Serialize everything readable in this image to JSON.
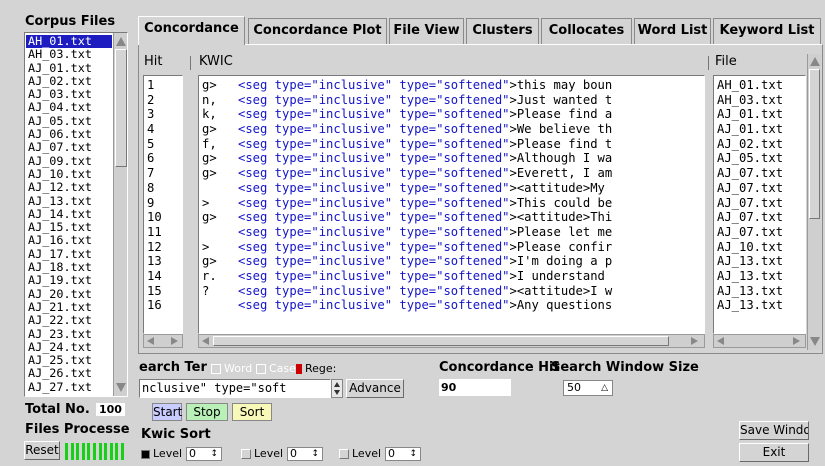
{
  "corpus": {
    "title": "Corpus Files",
    "files": [
      "AH_01.txt",
      "AH_03.txt",
      "AJ_01.txt",
      "AJ_02.txt",
      "AJ_03.txt",
      "AJ_04.txt",
      "AJ_05.txt",
      "AJ_06.txt",
      "AJ_07.txt",
      "AJ_09.txt",
      "AJ_10.txt",
      "AJ_12.txt",
      "AJ_13.txt",
      "AJ_14.txt",
      "AJ_15.txt",
      "AJ_16.txt",
      "AJ_17.txt",
      "AJ_18.txt",
      "AJ_19.txt",
      "AJ_20.txt",
      "AJ_21.txt",
      "AJ_22.txt",
      "AJ_23.txt",
      "AJ_24.txt",
      "AJ_25.txt",
      "AJ_26.txt",
      "AJ_27.txt"
    ],
    "selected_index": 0,
    "total_label": "Total No.",
    "total_value": "100",
    "processed_label": "Files Processe",
    "reset_label": "Reset"
  },
  "tabs": [
    "Concordance",
    "Concordance Plot",
    "File View",
    "Clusters",
    "Collocates",
    "Word List",
    "Keyword List"
  ],
  "active_tab": 0,
  "concordance": {
    "hit_header": "Hit",
    "kwic_header": "KWIC",
    "file_header": "File",
    "rows": [
      {
        "hit": "1",
        "left": "g>",
        "tag1": "<seg type=\"inclusive\"",
        "tag2": " type=\"softened\"",
        "rest": ">this may boun",
        "file": "AH_01.txt"
      },
      {
        "hit": "2",
        "left": "n,",
        "tag1": "<seg type=\"inclusive\"",
        "tag2": " type=\"softened\"",
        "rest": ">Just wanted t",
        "file": "AH_03.txt"
      },
      {
        "hit": "3",
        "left": "k,",
        "tag1": "<seg type=\"inclusive\"",
        "tag2": " type=\"softened\"",
        "rest": ">Please find a",
        "file": "AJ_01.txt"
      },
      {
        "hit": "4",
        "left": "g>",
        "tag1": "<seg type=\"inclusive\"",
        "tag2": " type=\"softened\"",
        "rest": ">We believe th",
        "file": "AJ_01.txt"
      },
      {
        "hit": "5",
        "left": "f,",
        "tag1": "<seg type=\"inclusive\"",
        "tag2": " type=\"softened\"",
        "rest": ">Please find t",
        "file": "AJ_02.txt"
      },
      {
        "hit": "6",
        "left": "g>",
        "tag1": "<seg type=\"inclusive\"",
        "tag2": " type=\"softened\"",
        "rest": ">Although I wa",
        "file": "AJ_05.txt"
      },
      {
        "hit": "7",
        "left": "g>",
        "tag1": "<seg type=\"inclusive\"",
        "tag2": " type=\"softened\"",
        "rest": ">Everett, I am",
        "file": "AJ_07.txt"
      },
      {
        "hit": "8",
        "left": "",
        "tag1": "<seg type=\"inclusive\"",
        "tag2": " type=\"softened\"",
        "rest": "><attitude>My",
        "file": "AJ_07.txt"
      },
      {
        "hit": "9",
        "left": ">",
        "tag1": "<seg type=\"inclusive\"",
        "tag2": " type=\"softened\"",
        "rest": ">This could be",
        "file": "AJ_07.txt"
      },
      {
        "hit": "10",
        "left": "g>",
        "tag1": "<seg type=\"inclusive\"",
        "tag2": " type=\"softened\"",
        "rest": "><attitude>Thi",
        "file": "AJ_07.txt"
      },
      {
        "hit": "11",
        "left": "",
        "tag1": "<seg type=\"inclusive\"",
        "tag2": " type=\"softened\"",
        "rest": ">Please let me",
        "file": "AJ_07.txt"
      },
      {
        "hit": "12",
        "left": ">",
        "tag1": "<seg type=\"inclusive\"",
        "tag2": " type=\"softened\"",
        "rest": ">Please confir",
        "file": "AJ_10.txt"
      },
      {
        "hit": "13",
        "left": "g>",
        "tag1": "<seg type=\"inclusive\"",
        "tag2": " type=\"softened\"",
        "rest": ">I'm doing a p",
        "file": "AJ_13.txt"
      },
      {
        "hit": "14",
        "left": "r.",
        "tag1": "<seg type=\"inclusive\"",
        "tag2": " type=\"softened\"",
        "rest": ">I understand",
        "file": "AJ_13.txt"
      },
      {
        "hit": "15",
        "left": "?",
        "tag1": "<seg type=\"inclusive\"",
        "tag2": " type=\"softened\"",
        "rest": "><attitude>I w",
        "file": "AJ_13.txt"
      },
      {
        "hit": "16",
        "left": "",
        "tag1": "<seg type=\"inclusive\"",
        "tag2": " type=\"softened\"",
        "rest": ">Any questions",
        "file": "AJ_13.txt"
      }
    ]
  },
  "search": {
    "term_label": "earch Ter",
    "word_label": "Word",
    "case_label": "Case",
    "regex_label": "Rege:",
    "input_value": "nclusive\" type=\"soft",
    "advanced_label": "Advance",
    "start_label": "Start",
    "stop_label": "Stop",
    "sort_label": "Sort"
  },
  "hits": {
    "label": "Concordance Hit",
    "value": "90"
  },
  "window": {
    "label": "Search Window Size",
    "value": "50"
  },
  "kwic_sort": {
    "label": "Kwic Sort",
    "level_label": "Level",
    "levels": [
      "0",
      "0",
      "0"
    ]
  },
  "save_label": "Save Windo",
  "exit_label": "Exit",
  "colors": {
    "selected": "#1c1cc0",
    "start_btn": "#c8ccff",
    "stop_btn": "#b8f0b8",
    "sort_btn": "#f8f8b8",
    "progress": "#18d018"
  }
}
